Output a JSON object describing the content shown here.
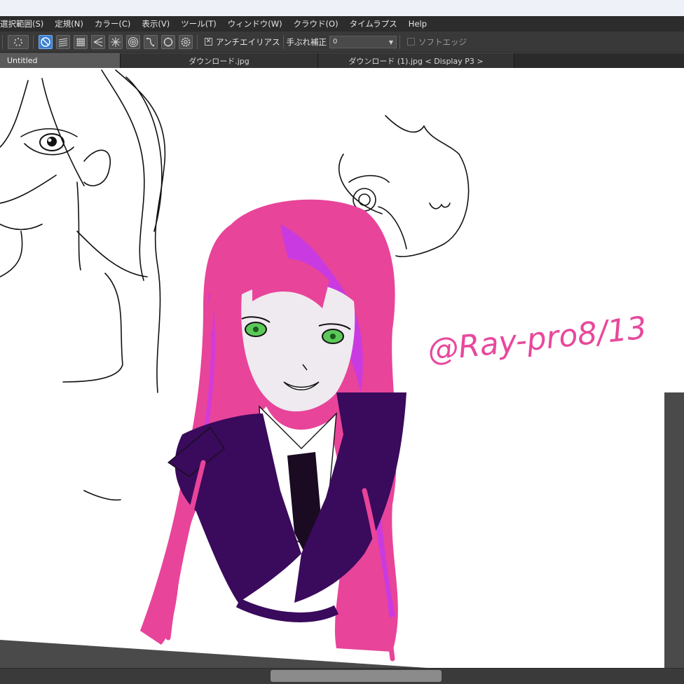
{
  "menu": {
    "items": [
      "選択範囲(S)",
      "定規(N)",
      "カラー(C)",
      "表示(V)",
      "ツール(T)",
      "ウィンドウ(W)",
      "クラウド(O)",
      "タイムラプス",
      "Help"
    ]
  },
  "toolbar": {
    "antialias_label": "アンチエイリアス",
    "stabilizer_label": "手ぶれ補正",
    "stabilizer_value": "0",
    "soft_edge_label": "ソフトエッジ",
    "antialias_checked": true,
    "soft_edge_checked": false,
    "active_tool_icon": "no-snap-icon"
  },
  "tabs": [
    {
      "label": "Untitled",
      "active": true
    },
    {
      "label": "ダウンロード.jpg",
      "active": false
    },
    {
      "label": "ダウンロード (1).jpg < Display P3 >",
      "active": false
    }
  ],
  "canvas": {
    "signature_text": "@Ray-pro8/13",
    "signature_color": "#e8489c",
    "hair_color": "#e8449a",
    "hair_highlight": "#c93be0",
    "jacket_color": "#3a0a5c",
    "eye_color": "#5cc85a"
  },
  "colors": {
    "menubar_bg": "#2c2c2c",
    "toolbar_bg": "#393939",
    "active_button": "#3b7fd3",
    "canvas_bg": "#ffffff",
    "workspace_bg": "#4a4a4a"
  }
}
